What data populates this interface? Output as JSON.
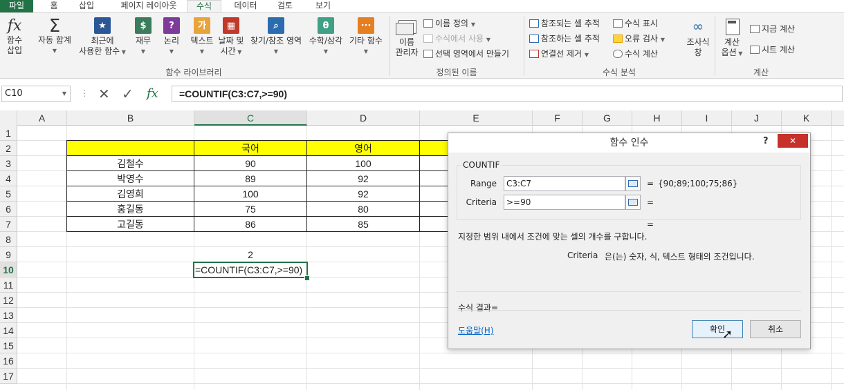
{
  "tabs": [
    "파일",
    "홈",
    "삽입",
    "페이지 레이아웃",
    "수식",
    "데이터",
    "검토",
    "보기"
  ],
  "ribbon": {
    "func_library": {
      "insert_fn": [
        "함수",
        "삽입"
      ],
      "autosum": "자동 합계",
      "recent": [
        "최근에",
        "사용한 함수"
      ],
      "finance": "재무",
      "logical": "논리",
      "text": "텍스트",
      "datetime": [
        "날짜 및",
        "시간"
      ],
      "lookup": "찾기/참조 영역",
      "math": "수학/삼각",
      "more": "기타 함수",
      "label": "함수 라이브러리"
    },
    "defined_names": {
      "name_manager": [
        "이름",
        "관리자"
      ],
      "define_name": "이름 정의",
      "use_in_formula": "수식에서 사용",
      "create_from_sel": "선택 영역에서 만들기",
      "label": "정의된 이름"
    },
    "auditing": {
      "trace_precedents": "참조되는 셀 추적",
      "trace_dependents": "참조하는 셀 추적",
      "remove_arrows": "연결선 제거",
      "show_formulas": "수식 표시",
      "error_check": "오류 검사",
      "evaluate": "수식 계산",
      "watch": [
        "조사식",
        "창"
      ],
      "label": "수식 분석"
    },
    "calculation": {
      "options": [
        "계산",
        "옵션"
      ],
      "calc_now": "지금 계산",
      "calc_sheet": "시트 계산",
      "label": "계산"
    }
  },
  "namebox": "C10",
  "formula": "=COUNTIF(C3:C7,>=90)",
  "columns": [
    "A",
    "B",
    "C",
    "D",
    "E",
    "F",
    "G",
    "H",
    "I",
    "J",
    "K"
  ],
  "rows": [
    "1",
    "2",
    "3",
    "4",
    "5",
    "6",
    "7",
    "8",
    "9",
    "10",
    "11",
    "12",
    "13",
    "14",
    "15",
    "16",
    "17"
  ],
  "sheet": {
    "header": [
      "",
      "국어",
      "영어"
    ],
    "data": [
      [
        "김철수",
        "90",
        "100"
      ],
      [
        "박영수",
        "89",
        "92"
      ],
      [
        "김영희",
        "100",
        "92"
      ],
      [
        "홍길동",
        "75",
        "80"
      ],
      [
        "고길동",
        "86",
        "85"
      ]
    ],
    "c9": "2",
    "c10": "=COUNTIF(C3:C7,>=90)"
  },
  "dialog": {
    "title": "함수 인수",
    "help_q": "?",
    "func_name": "COUNTIF",
    "range_label": "Range",
    "range_value": "C3:C7",
    "range_eq": "=",
    "range_result": "{90;89;100;75;86}",
    "criteria_label": "Criteria",
    "criteria_value": ">=90",
    "criteria_eq": "=",
    "result_eq": "=",
    "description": "지정한 범위 내에서 조건에 맞는 셀의 개수를 구합니다.",
    "arg_name": "Criteria",
    "arg_desc": "은(는) 숫자, 식, 텍스트 형태의 조건입니다.",
    "result_label": "수식 결과=",
    "help_link": "도움말(H)",
    "ok": "확인",
    "cancel": "취소"
  }
}
